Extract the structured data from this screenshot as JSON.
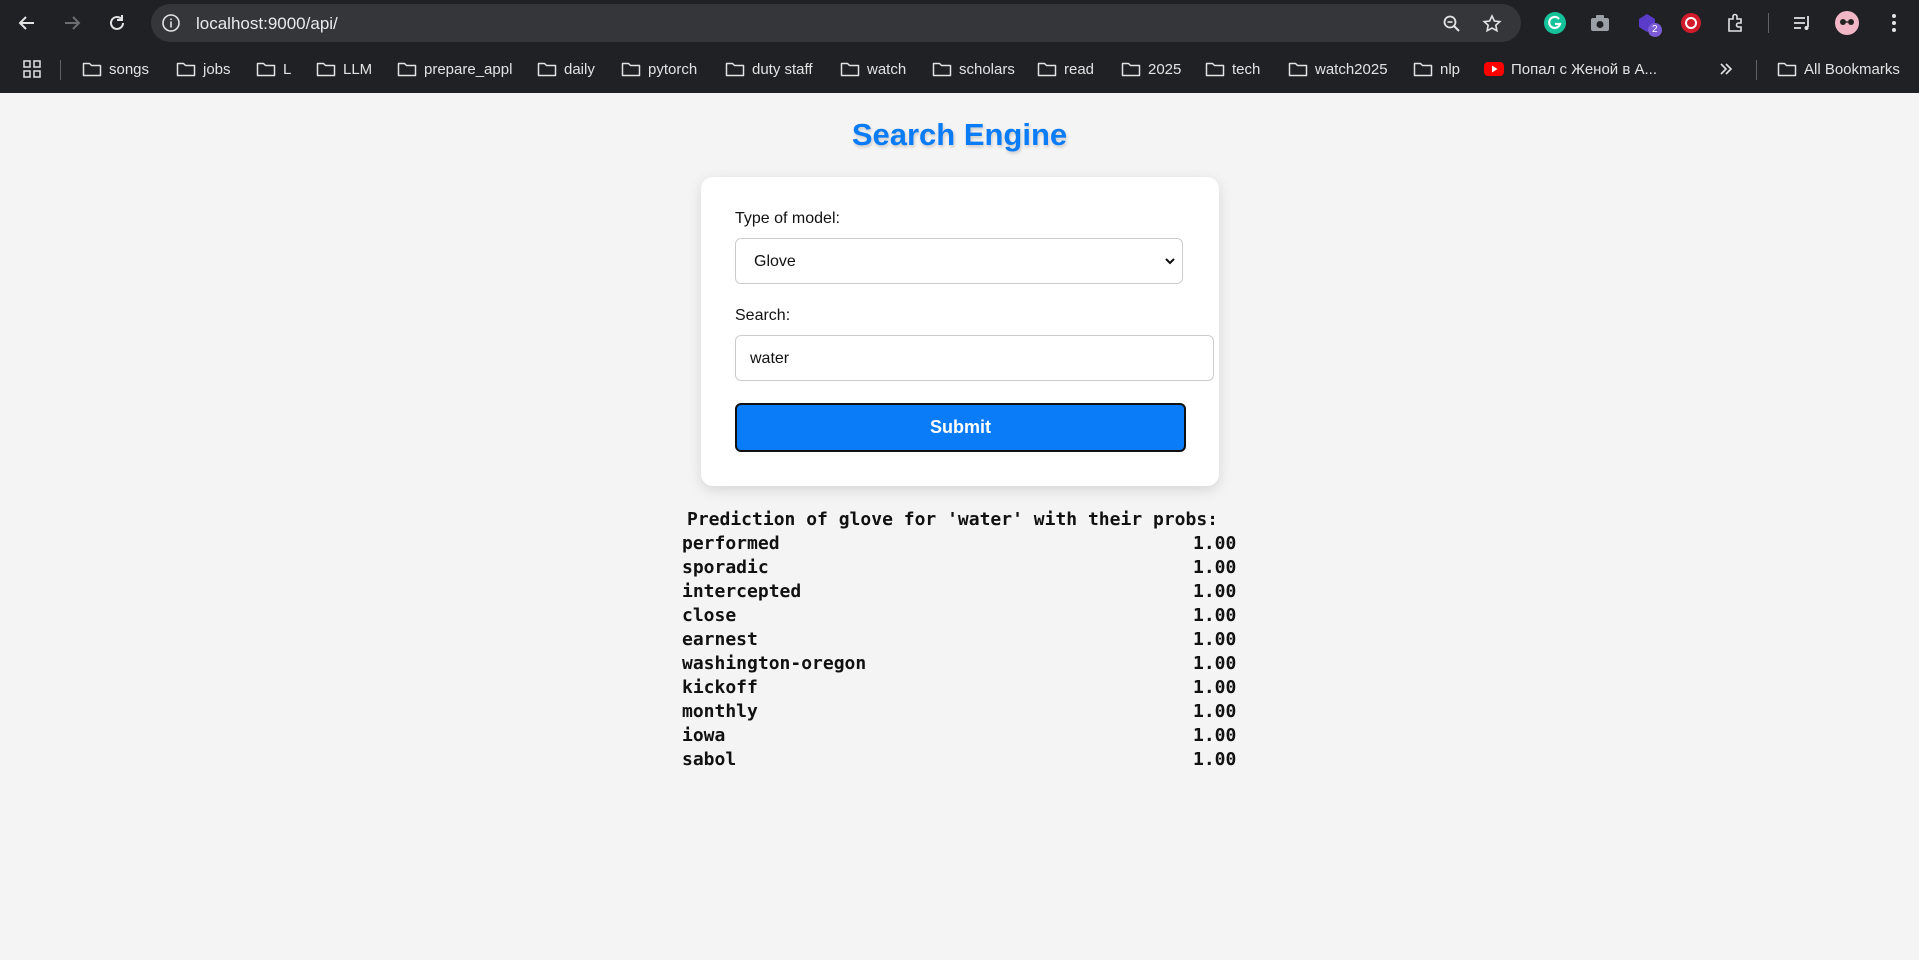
{
  "browser": {
    "url": "localhost:9000/api/",
    "extension_badge": "2",
    "bookmarks": [
      {
        "label": "songs",
        "type": "folder"
      },
      {
        "label": "jobs",
        "type": "folder"
      },
      {
        "label": "L",
        "type": "folder"
      },
      {
        "label": "LLM",
        "type": "folder"
      },
      {
        "label": "prepare_appl",
        "type": "folder"
      },
      {
        "label": "daily",
        "type": "folder"
      },
      {
        "label": "pytorch",
        "type": "folder"
      },
      {
        "label": "duty staff",
        "type": "folder"
      },
      {
        "label": "watch",
        "type": "folder"
      },
      {
        "label": "scholars",
        "type": "folder"
      },
      {
        "label": "read",
        "type": "folder"
      },
      {
        "label": "2025",
        "type": "folder"
      },
      {
        "label": "tech",
        "type": "folder"
      },
      {
        "label": "watch2025",
        "type": "folder"
      },
      {
        "label": "nlp",
        "type": "folder"
      },
      {
        "label": "Попал с Женой в А...",
        "type": "youtube"
      }
    ],
    "all_bookmarks": "All Bookmarks"
  },
  "page": {
    "title": "Search Engine",
    "form": {
      "model_label": "Type of model:",
      "model_value": "Glove",
      "search_label": "Search:",
      "search_value": "water",
      "submit_label": "Submit"
    },
    "results": {
      "header": "Prediction of glove for 'water' with their probs:",
      "rows": [
        {
          "word": "performed",
          "prob": "1.00"
        },
        {
          "word": "sporadic",
          "prob": "1.00"
        },
        {
          "word": "intercepted",
          "prob": "1.00"
        },
        {
          "word": "close",
          "prob": "1.00"
        },
        {
          "word": "earnest",
          "prob": "1.00"
        },
        {
          "word": "washington-oregon",
          "prob": "1.00"
        },
        {
          "word": "kickoff",
          "prob": "1.00"
        },
        {
          "word": "monthly",
          "prob": "1.00"
        },
        {
          "word": "iowa",
          "prob": "1.00"
        },
        {
          "word": "sabol",
          "prob": "1.00"
        }
      ]
    }
  },
  "colors": {
    "accent": "#0a7cf7",
    "page_bg": "#f4f4f4",
    "chrome_bg": "#202124"
  }
}
